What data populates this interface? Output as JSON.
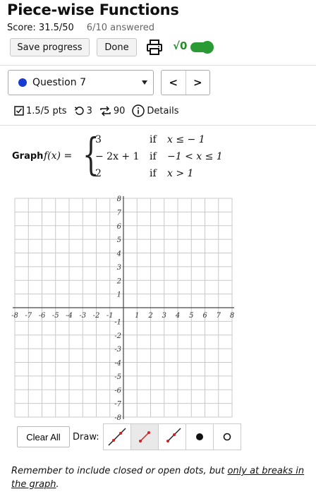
{
  "header": {
    "title": "Piece-wise Functions",
    "score": "Score: 31.5/50",
    "answered": "6/10 answered",
    "save_label": "Save progress",
    "done_label": "Done",
    "sqrt_label": "√0"
  },
  "question_nav": {
    "selected": "Question 7",
    "prev_label": "<",
    "next_label": ">"
  },
  "meta": {
    "points": "1.5/5 pts",
    "retries": "3",
    "attempts": "90",
    "details_label": "Details"
  },
  "problem": {
    "graph_label": "Graph",
    "function": "f(x) =",
    "cases": [
      {
        "value": "3",
        "if": "if",
        "condition": "x ≤ − 1"
      },
      {
        "value": "− 2x + 1",
        "if": "if",
        "condition": "−1 < x ≤ 1"
      },
      {
        "value": "2",
        "if": "if",
        "condition": "x > 1"
      }
    ]
  },
  "chart_data": {
    "type": "scatter",
    "xlim": [
      -8,
      8
    ],
    "ylim": [
      -8,
      8
    ],
    "x_ticks": [
      "-8",
      "-7",
      "-6",
      "-5",
      "-4",
      "-3",
      "-2",
      "-1",
      "1",
      "2",
      "3",
      "4",
      "5",
      "6",
      "7",
      "8"
    ],
    "y_ticks": [
      "8",
      "7",
      "6",
      "5",
      "4",
      "3",
      "2",
      "1",
      "-1",
      "-2",
      "-3",
      "-4",
      "-5",
      "-6",
      "-7",
      "-8"
    ],
    "grid": true,
    "series": []
  },
  "tools": {
    "clear_label": "Clear All",
    "draw_label": "Draw:",
    "items": [
      {
        "name": "line-tool-icon",
        "active": false
      },
      {
        "name": "segment-tool-icon",
        "active": true
      },
      {
        "name": "ray-tool-icon",
        "active": false
      },
      {
        "name": "closed-dot-tool-icon",
        "active": false
      },
      {
        "name": "open-dot-tool-icon",
        "active": false
      }
    ]
  },
  "reminder": {
    "text_before": "Remember to include closed or open dots, but ",
    "underlined": "only at breaks in the graph",
    "text_after": "."
  },
  "colors": {
    "accent_green": "#2a9a34",
    "question_dot": "#1a3bd1",
    "tool_red": "#d42020"
  }
}
